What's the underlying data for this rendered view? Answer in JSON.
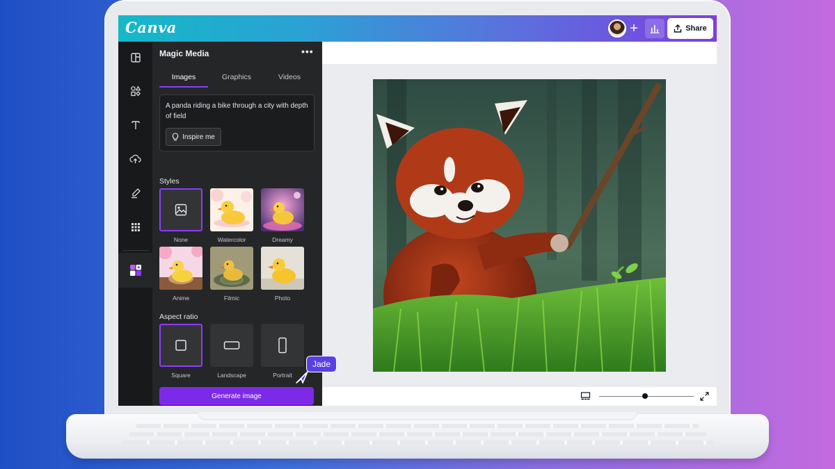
{
  "app": {
    "logo": "Canva"
  },
  "header": {
    "share_label": "Share"
  },
  "panel": {
    "title": "Magic Media",
    "tabs": [
      {
        "label": "Images",
        "active": true
      },
      {
        "label": "Graphics",
        "active": false
      },
      {
        "label": "Videos",
        "active": false
      }
    ],
    "prompt": "A panda riding a bike through a city with depth of field",
    "inspire_label": "Inspire me",
    "styles_label": "Styles",
    "styles": [
      {
        "label": "None",
        "selected": true
      },
      {
        "label": "Watercolor",
        "selected": false
      },
      {
        "label": "Dreamy",
        "selected": false
      },
      {
        "label": "Anime",
        "selected": false
      },
      {
        "label": "Filmic",
        "selected": false
      },
      {
        "label": "Photo",
        "selected": false
      }
    ],
    "aspect_label": "Aspect ratio",
    "aspects": [
      {
        "label": "Square",
        "selected": true
      },
      {
        "label": "Landscape",
        "selected": false
      },
      {
        "label": "Portrait",
        "selected": false
      }
    ],
    "generate_label": "Generate image"
  },
  "collaborator": {
    "name": "Jade"
  },
  "colors": {
    "accent": "#8b3dff",
    "button": "#7d2ae8",
    "cursor": "#5b3fe6"
  },
  "icons": {
    "rail": [
      "layout-icon",
      "elements-icon",
      "text-icon",
      "upload-icon",
      "draw-icon",
      "apps-icon",
      "magic-media-icon"
    ]
  }
}
